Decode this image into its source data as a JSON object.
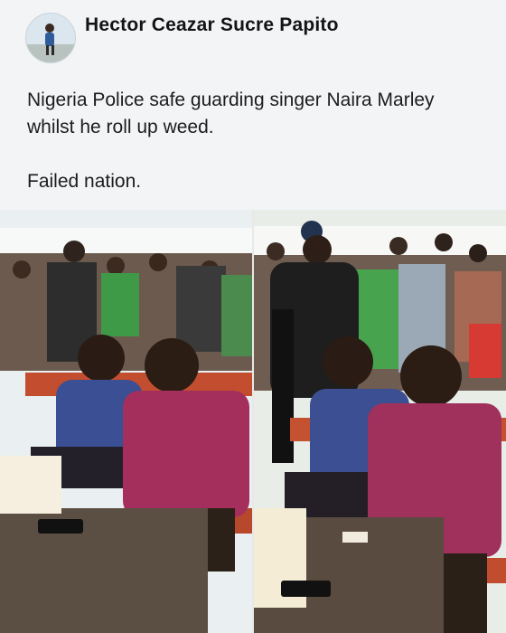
{
  "post": {
    "author": "Hector Ceazar Sucre Papito",
    "text_line1": "Nigeria Police safe guarding singer Naira Marley",
    "text_line2": "whilst he roll up weed.",
    "text_line3": "Failed nation."
  },
  "photos": [
    {
      "name": "left-photo",
      "icon": "photo"
    },
    {
      "name": "right-photo",
      "icon": "photo"
    }
  ]
}
